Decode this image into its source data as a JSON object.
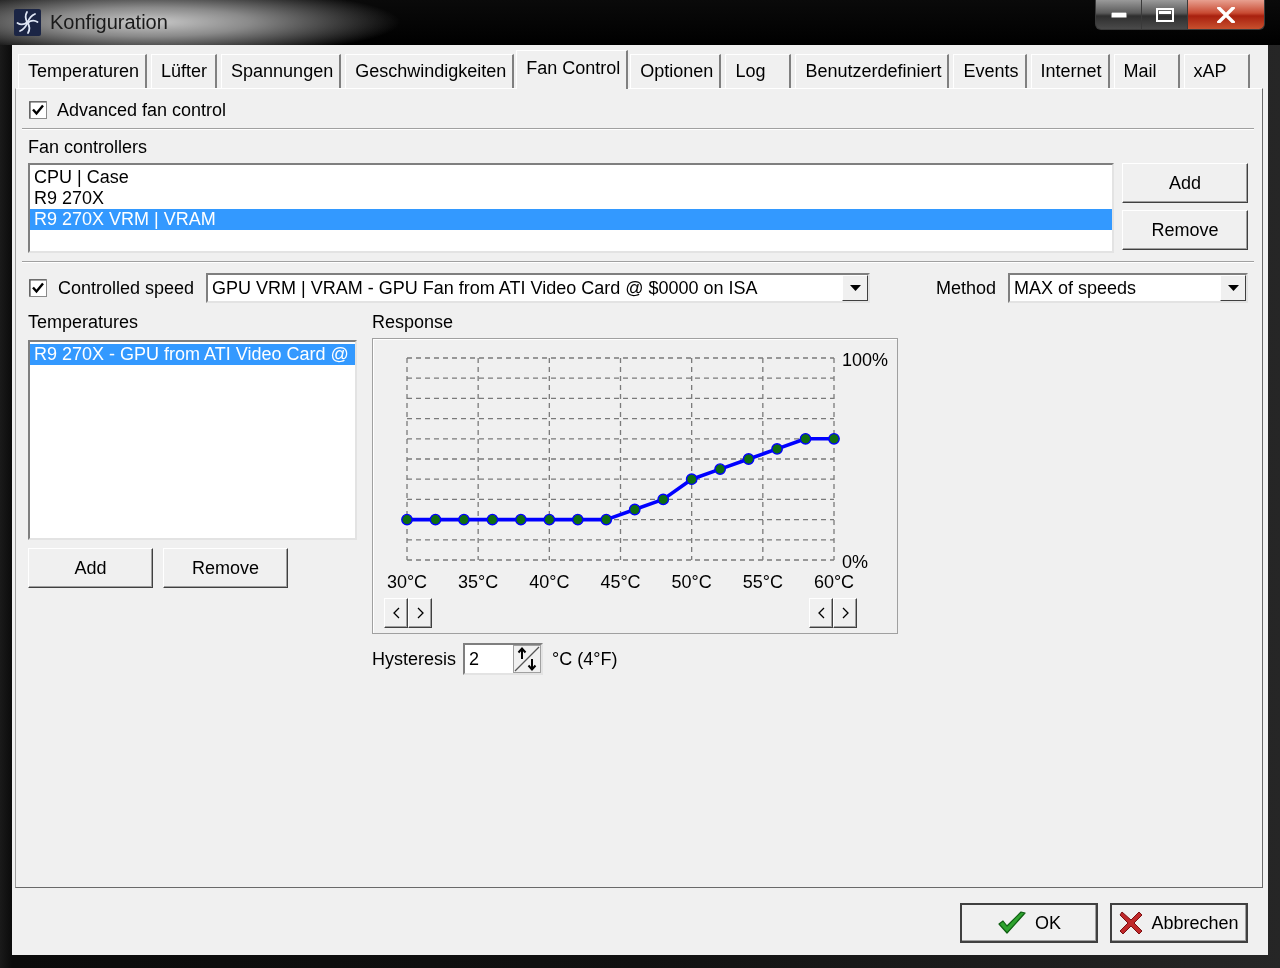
{
  "window": {
    "title": "Konfiguration"
  },
  "tabs": [
    {
      "label": "Temperaturen",
      "selected": false
    },
    {
      "label": "Lüfter",
      "selected": false
    },
    {
      "label": "Spannungen",
      "selected": false
    },
    {
      "label": "Geschwindigkeiten",
      "selected": false
    },
    {
      "label": "Fan Control",
      "selected": true
    },
    {
      "label": "Optionen",
      "selected": false
    },
    {
      "label": "Log",
      "selected": false
    },
    {
      "label": "Benutzerdefiniert",
      "selected": false
    },
    {
      "label": "Events",
      "selected": false
    },
    {
      "label": "Internet",
      "selected": false
    },
    {
      "label": "Mail",
      "selected": false
    },
    {
      "label": "xAP",
      "selected": false
    }
  ],
  "advanced_fan_control": {
    "label": "Advanced fan control",
    "checked": true
  },
  "fan_controllers": {
    "label": "Fan controllers",
    "items": [
      {
        "label": "CPU | Case",
        "selected": false
      },
      {
        "label": "R9 270X",
        "selected": false
      },
      {
        "label": "R9 270X VRM | VRAM",
        "selected": true
      }
    ],
    "buttons": [
      "Add",
      "Remove"
    ]
  },
  "controlled_speed": {
    "label": "Controlled speed",
    "checked": true,
    "value": "GPU VRM | VRAM - GPU Fan from ATI Video Card @ $0000 on ISA"
  },
  "method": {
    "label": "Method",
    "value": "MAX of speeds"
  },
  "temperatures": {
    "label": "Temperatures",
    "items": [
      {
        "label": "R9 270X - GPU from ATI Video Card @",
        "selected": true
      }
    ],
    "buttons": [
      "Add",
      "Remove"
    ]
  },
  "response": {
    "label": "Response",
    "chart_data": [
      {
        "type": "line",
        "x": [
          30,
          32,
          34,
          36,
          38,
          40,
          42,
          44,
          46,
          48,
          50,
          52,
          54,
          56,
          58,
          60
        ],
        "values": [
          20,
          20,
          20,
          20,
          20,
          20,
          20,
          20,
          25,
          30,
          40,
          45,
          50,
          55,
          60,
          60
        ],
        "color": "#0000ff",
        "marker": "circle",
        "grid": true,
        "xlim": [
          30,
          60
        ],
        "ylim": [
          0,
          100
        ],
        "xticks": [
          {
            "value": 30,
            "label": "30°C"
          },
          {
            "value": 35,
            "label": "35°C"
          },
          {
            "value": 40,
            "label": "40°C"
          },
          {
            "value": 45,
            "label": "45°C"
          },
          {
            "value": 50,
            "label": "50°C"
          },
          {
            "value": 55,
            "label": "55°C"
          },
          {
            "value": 60,
            "label": "60°C"
          }
        ],
        "yticks": [
          {
            "value": 0,
            "label": "0%"
          },
          {
            "value": 100,
            "label": "100%"
          }
        ]
      }
    ]
  },
  "hysteresis": {
    "label": "Hysteresis",
    "value": "2",
    "unit": "°C (4°F)"
  },
  "dialog_buttons": [
    {
      "label": "OK",
      "kind": "ok"
    },
    {
      "label": "Abbrechen",
      "kind": "cancel"
    }
  ]
}
